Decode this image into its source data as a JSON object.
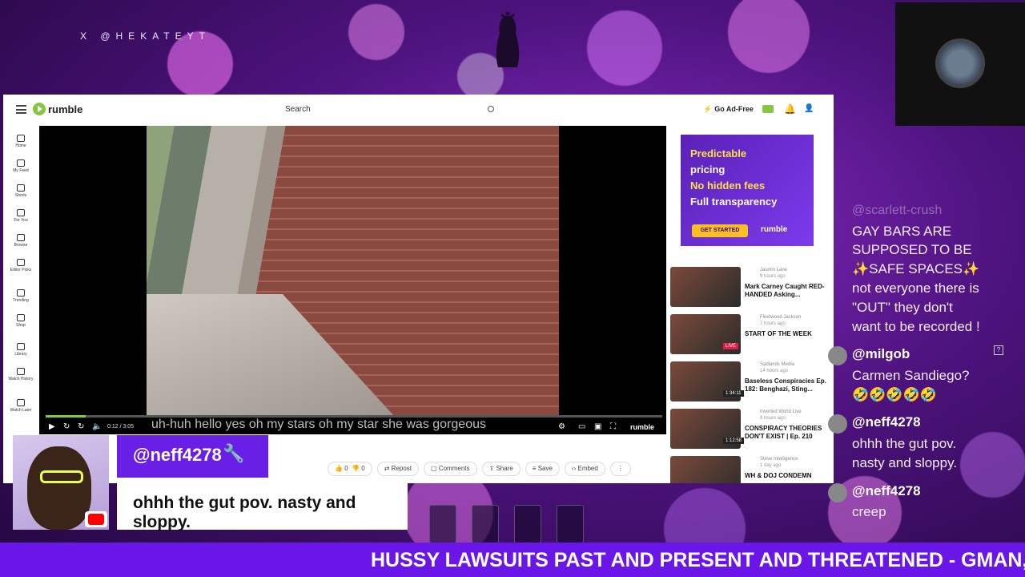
{
  "overlay": {
    "handle": "X @HEKATEYT"
  },
  "browser": {
    "logo": "rumble",
    "search_placeholder": "Search",
    "go_ad_free": "Go Ad-Free",
    "nav": [
      {
        "label": "Home",
        "icon": "home-icon"
      },
      {
        "label": "My Feed",
        "icon": "feed-icon"
      },
      {
        "label": "Shorts",
        "icon": "shorts-icon"
      },
      {
        "label": "For You",
        "icon": "for-you-icon"
      },
      {
        "label": "Browse",
        "icon": "browse-icon"
      },
      {
        "label": "Editor Picks",
        "icon": "editor-picks-icon"
      },
      {
        "label": "Trending",
        "icon": "trending-icon"
      },
      {
        "label": "Shop",
        "icon": "shop-icon"
      },
      {
        "label": "Library",
        "icon": "library-icon"
      },
      {
        "label": "Watch History",
        "icon": "history-icon"
      },
      {
        "label": "Watch Later",
        "icon": "watch-later-icon"
      }
    ],
    "player": {
      "time": "0:12 / 3:05",
      "subtitle": "uh-huh hello yes oh my stars oh my star she was gorgeous",
      "brand": "rumble",
      "progress_fraction": 0.065
    },
    "actions": {
      "like_count": "0",
      "dislike_count": "0",
      "repost": "Repost",
      "comments": "Comments",
      "share": "Share",
      "save": "Save",
      "embed": "Embed"
    },
    "ad": {
      "line1": "Predictable",
      "line2": "pricing",
      "line3": "No hidden fees",
      "line4": "Full transparency",
      "button": "GET STARTED",
      "brand": "rumble"
    },
    "recommended": [
      {
        "channel": "Jasmin Lane",
        "ago": "9 hours ago",
        "title": "Mark Carney Caught RED-HANDED Asking...",
        "badge": ""
      },
      {
        "channel": "Fleetwood Jackson",
        "ago": "7 hours ago",
        "title": "START OF THE WEEK",
        "badge": "LIVE"
      },
      {
        "channel": "Sadlands Media",
        "ago": "14 hours ago",
        "title": "Baseless Conspiracies Ep. 182: Benghazi, Sting...",
        "badge": "1:34:11"
      },
      {
        "channel": "Inverted World Live",
        "ago": "9 hours ago",
        "title": "CONSPIRACY THEORIES DON'T EXIST | Ep. 210",
        "badge": "1:12:58"
      },
      {
        "channel": "Steve Intelligence",
        "ago": "1 day ago",
        "title": "WH & DOJ CONDEMN",
        "badge": ""
      }
    ]
  },
  "chat": {
    "faded_user": "@scarlett-crush",
    "messages": [
      {
        "user": "",
        "lines": [
          "GAY BARS ARE",
          "SUPPOSED TO BE",
          "✨SAFE SPACES✨",
          "not everyone there is",
          "\"OUT\" they don't",
          "want to be recorded !"
        ]
      },
      {
        "user": "@milgob",
        "lines": [
          "Carmen Sandiego?",
          "🤣🤣🤣🤣🤣"
        ]
      },
      {
        "user": "@neff4278",
        "lines": [
          "ohhh the gut pov.",
          "nasty and sloppy."
        ]
      },
      {
        "user": "@neff4278",
        "lines": [
          "creep"
        ]
      }
    ]
  },
  "highlight": {
    "username": "@neff4278",
    "comment": "ohhh the gut pov. nasty and sloppy."
  },
  "ticker": {
    "text": "HUSSY LAWSUITS PAST AND PRESENT AND THREATENED - GMAN, AZRIA, AK, TR"
  }
}
